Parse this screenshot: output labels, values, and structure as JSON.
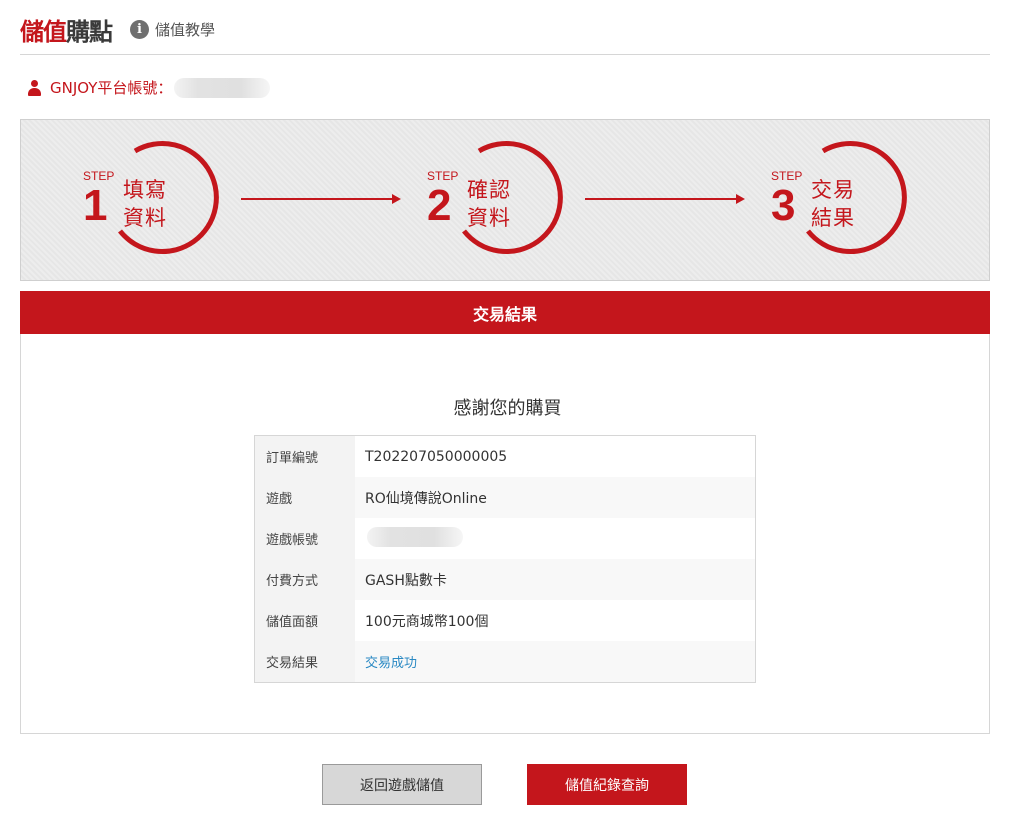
{
  "header": {
    "title_part1": "儲值",
    "title_part2": "購點",
    "tutorial_icon": "info-icon",
    "tutorial_label": "儲值教學"
  },
  "account": {
    "icon": "user-icon",
    "label": "GNJOY平台帳號："
  },
  "steps": [
    {
      "tag": "STEP",
      "number": "1",
      "line1": "填寫",
      "line2": "資料"
    },
    {
      "tag": "STEP",
      "number": "2",
      "line1": "確認",
      "line2": "資料"
    },
    {
      "tag": "STEP",
      "number": "3",
      "line1": "交易",
      "line2": "結果"
    }
  ],
  "result": {
    "panel_title": "交易結果",
    "thanks": "感謝您的購買",
    "rows": [
      {
        "key": "訂單編號",
        "value": "T202207050000005"
      },
      {
        "key": "遊戲",
        "value": "RO仙境傳說Online"
      },
      {
        "key": "遊戲帳號",
        "value": ""
      },
      {
        "key": "付費方式",
        "value": "GASH點數卡"
      },
      {
        "key": "儲值面額",
        "value": "100元商城幣100個"
      },
      {
        "key": "交易結果",
        "value": "交易成功"
      }
    ]
  },
  "buttons": {
    "back": "返回遊戲儲值",
    "query": "儲值紀錄查詢"
  },
  "colors": {
    "brand_red": "#c4161c",
    "success_blue": "#2a89c3"
  }
}
